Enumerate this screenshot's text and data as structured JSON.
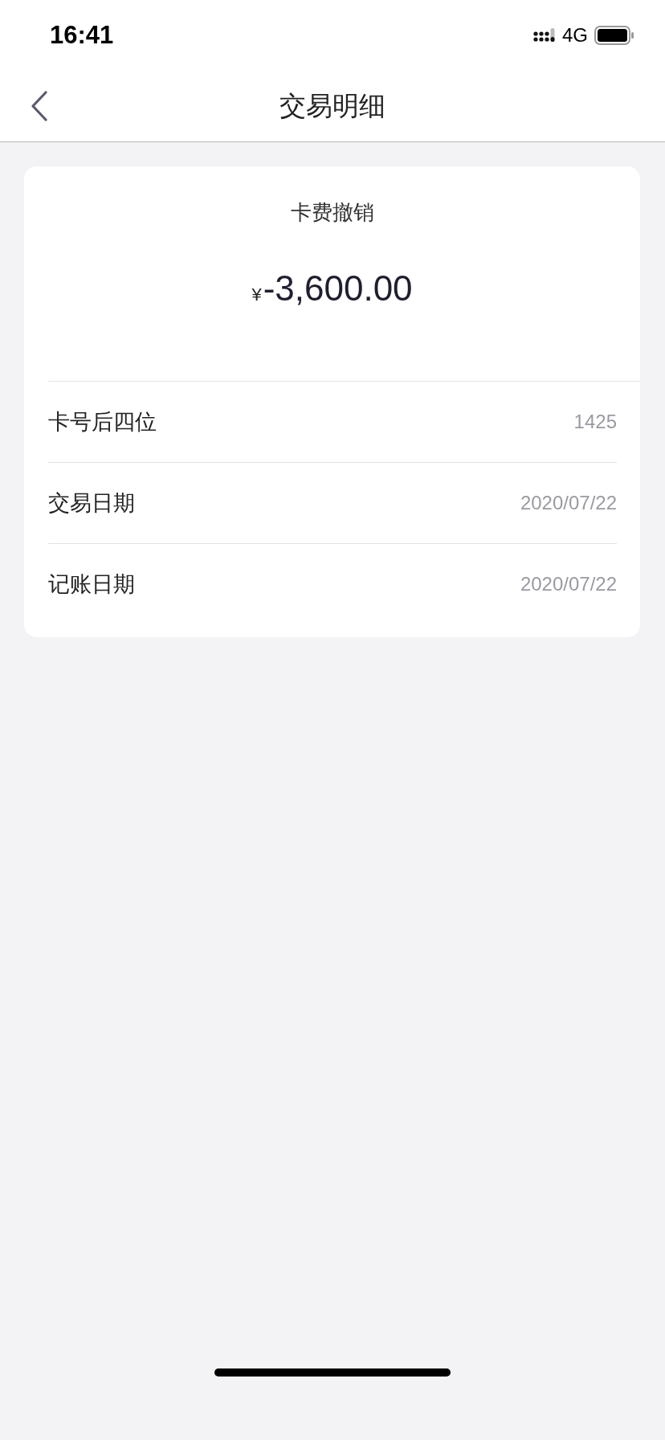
{
  "status_bar": {
    "time": "16:41",
    "network": "4G"
  },
  "nav": {
    "title": "交易明细"
  },
  "transaction": {
    "title": "卡费撤销",
    "currency": "¥",
    "amount": "-3,600.00"
  },
  "details": [
    {
      "label": "卡号后四位",
      "value": "1425"
    },
    {
      "label": "交易日期",
      "value": "2020/07/22"
    },
    {
      "label": "记账日期",
      "value": "2020/07/22"
    }
  ]
}
